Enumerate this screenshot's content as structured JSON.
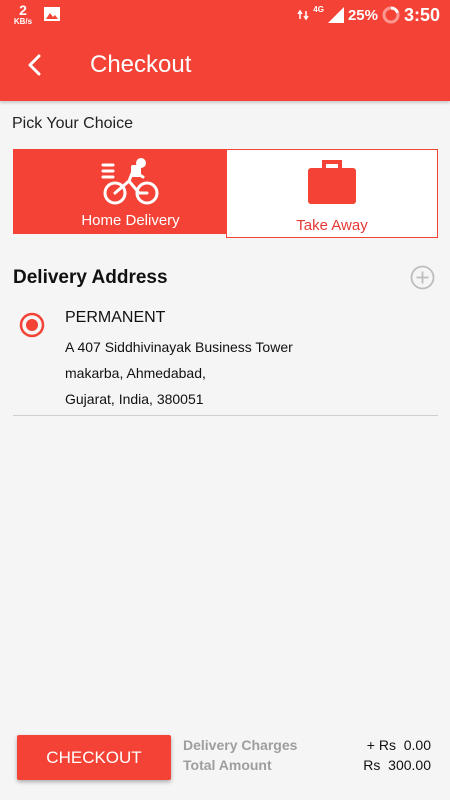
{
  "status_bar": {
    "speed_value": "2",
    "speed_unit": "KB/s",
    "network": "4G",
    "battery": "25%",
    "time": "3:50"
  },
  "toolbar": {
    "title": "Checkout",
    "back_icon": "chevron-left-icon"
  },
  "pick": {
    "label": "Pick Your Choice",
    "options": [
      {
        "label": "Home Delivery",
        "icon": "delivery-bike-icon",
        "selected": true
      },
      {
        "label": "Take Away",
        "icon": "briefcase-icon",
        "selected": false
      }
    ]
  },
  "address": {
    "heading": "Delivery Address",
    "add_icon": "add-circle-icon",
    "items": [
      {
        "type": "PERMANENT",
        "line1": "A 407 Siddhivinayak Business Tower",
        "line2": "makarba, Ahmedabad,",
        "line3": "Gujarat, India, 380051",
        "selected": true
      }
    ]
  },
  "footer": {
    "checkout_label": "CHECKOUT",
    "delivery_label": "Delivery Charges",
    "delivery_value": "+ Rs  0.00",
    "total_label": "Total Amount",
    "total_value": "Rs  300.00"
  },
  "colors": {
    "primary": "#f44336",
    "text": "#111111",
    "muted": "#9e9e9e"
  }
}
